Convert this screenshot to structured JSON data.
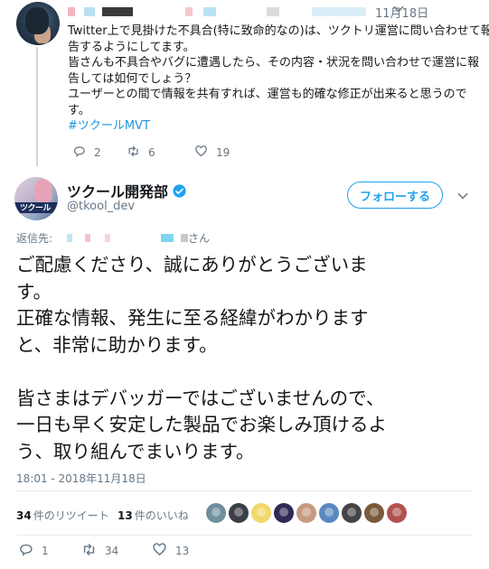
{
  "parent_tweet": {
    "date": "11月18日",
    "lines": [
      "Twitter上で見掛けた不具合(特に致命的なの)は、ツクトリ運営に問い合わせて報",
      "告するようにしてます。",
      "皆さんも不具合やバグに遭遇したら、その内容・状況を問い合わせで運営に報",
      "告しては如何でしょう？",
      "ユーザーとの間で情報を共有すれば、運営も的確な修正が出来ると思うので",
      "す。"
    ],
    "hashtag": "#ツクールMVT",
    "counts": {
      "replies": "2",
      "retweets": "6",
      "likes": "19"
    }
  },
  "tweet": {
    "author": {
      "name": "ツクール開発部",
      "handle": "@tkool_dev",
      "avatar_text": "ツクール"
    },
    "follow_label": "フォローする",
    "reply_to_label": "返信先:",
    "reply_to_suffix": "さん",
    "body_lines": [
      "ご配慮くださり、誠にありがとうございま",
      "す。",
      "正確な情報、発生に至る経緯がわかります",
      "と、非常に助かります。",
      "",
      "皆さまはデバッガーではございませんので、",
      "一日も早く安定した製品でお楽しみ頂けるよ",
      "う、取り組んでまいります。"
    ],
    "timestamp": "18:01 - 2018年11月18日",
    "stats": {
      "retweet_count": "34",
      "retweet_label": "件のリツイート",
      "like_count": "13",
      "like_label": "件のいいね"
    },
    "liker_colors": [
      "#6f8f9e",
      "#3b3f46",
      "#f2d86a",
      "#2f2a55",
      "#c79a80",
      "#5a87c0",
      "#444444",
      "#7a5a3a",
      "#b0524f"
    ],
    "counts": {
      "replies": "1",
      "retweets": "34",
      "likes": "13"
    }
  },
  "colors": {
    "accent": "#1da1f2",
    "muted": "#657786",
    "text": "#14171a",
    "hashtag": "#1b95e0"
  }
}
